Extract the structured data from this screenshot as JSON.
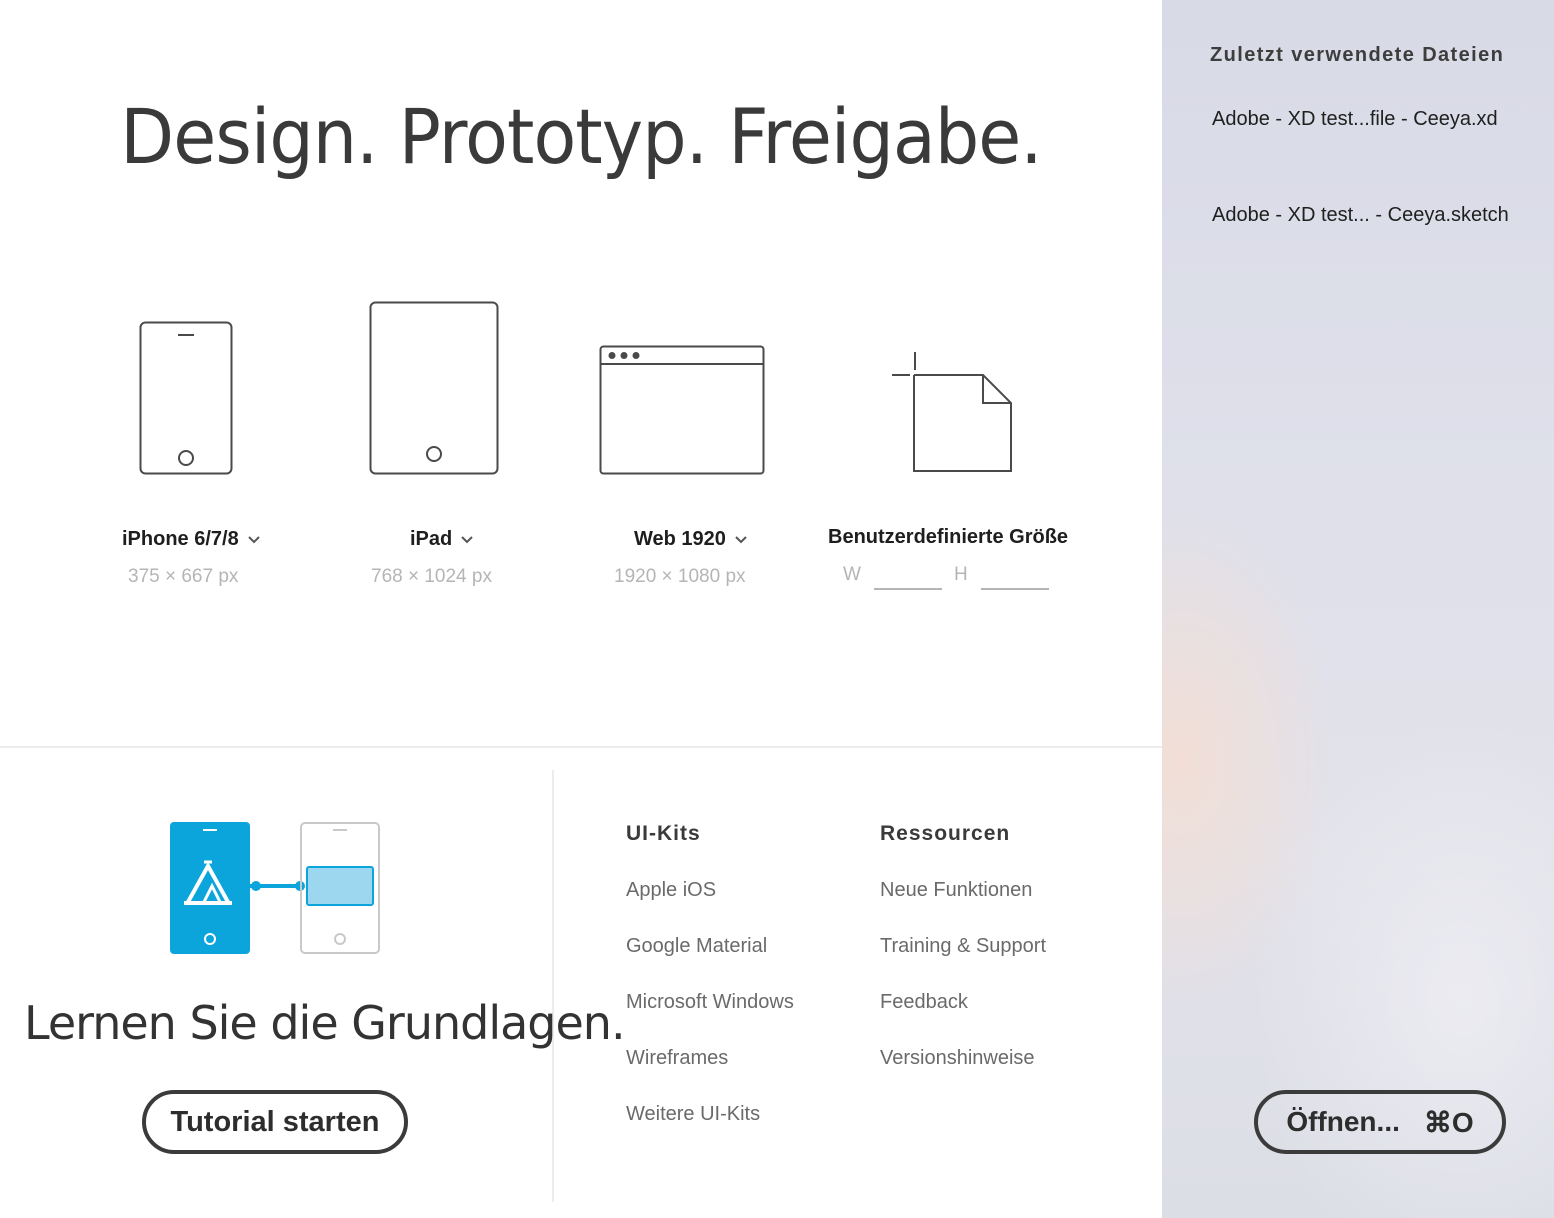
{
  "main": {
    "headline": "Design. Prototyp. Freigabe.",
    "presets": [
      {
        "label": "iPhone 6/7/8",
        "size": "375 × 667 px"
      },
      {
        "label": "iPad",
        "size": "768 × 1024 px"
      },
      {
        "label": "Web 1920",
        "size": "1920 × 1080 px"
      }
    ],
    "custom": {
      "label": "Benutzerdefinierte Größe",
      "w_label": "W",
      "h_label": "H",
      "w_value": "",
      "h_value": ""
    },
    "learn": {
      "title": "Lernen Sie die Grundlagen.",
      "button": "Tutorial starten",
      "accent": "#0ba5dc"
    },
    "ui_kits": {
      "title": "UI-Kits",
      "items": [
        "Apple iOS",
        "Google Material",
        "Microsoft Windows",
        "Wireframes",
        "Weitere UI-Kits"
      ]
    },
    "resources": {
      "title": "Ressourcen",
      "items": [
        "Neue Funktionen",
        "Training & Support",
        "Feedback",
        "Versionshinweise"
      ]
    }
  },
  "sidebar": {
    "title": "Zuletzt verwendete Dateien",
    "recent_files": [
      "Adobe - XD test...file - Ceeya.xd",
      "Adobe - XD test... - Ceeya.sketch"
    ],
    "open_button": {
      "label": "Öffnen...",
      "shortcut": "⌘O"
    }
  }
}
